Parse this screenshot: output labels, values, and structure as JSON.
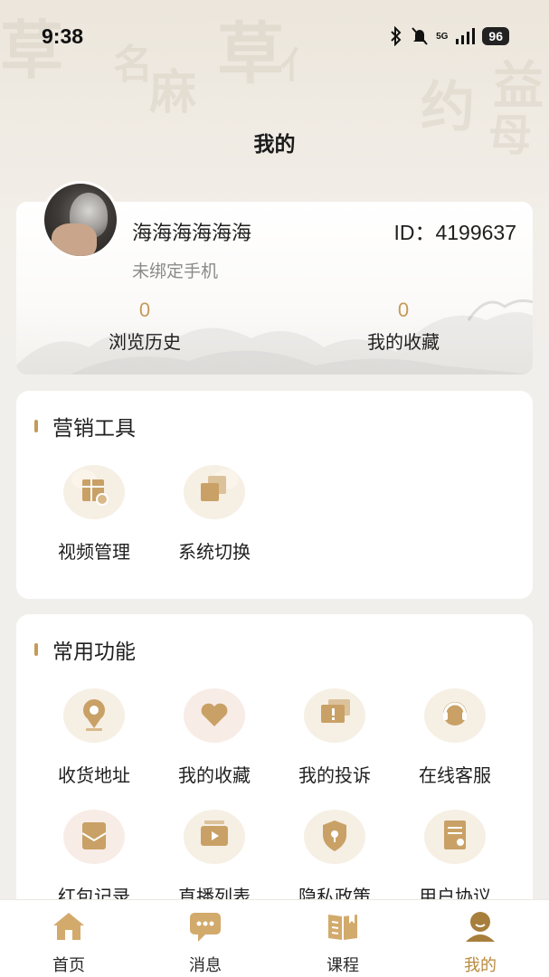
{
  "status_bar": {
    "time": "9:38",
    "network": "5G",
    "battery": "96"
  },
  "header": {
    "title": "我的"
  },
  "profile": {
    "username": "海海海海海海",
    "id_text": "ID：4199637",
    "phone_status": "未绑定手机",
    "stats": [
      {
        "value": "0",
        "label": "浏览历史"
      },
      {
        "value": "0",
        "label": "我的收藏"
      }
    ]
  },
  "marketing": {
    "title": "营销工具",
    "items": [
      {
        "label": "视频管理",
        "icon": "video-manage-icon"
      },
      {
        "label": "系统切换",
        "icon": "system-switch-icon"
      }
    ]
  },
  "common": {
    "title": "常用功能",
    "items": [
      {
        "label": "收货地址",
        "icon": "location-pin-icon"
      },
      {
        "label": "我的收藏",
        "icon": "heart-icon"
      },
      {
        "label": "我的投诉",
        "icon": "complaint-icon"
      },
      {
        "label": "在线客服",
        "icon": "headset-icon"
      },
      {
        "label": "红包记录",
        "icon": "red-envelope-icon"
      },
      {
        "label": "直播列表",
        "icon": "live-camera-icon"
      },
      {
        "label": "隐私政策",
        "icon": "shield-lock-icon"
      },
      {
        "label": "用户协议",
        "icon": "agreement-icon"
      }
    ]
  },
  "tab_bar": {
    "items": [
      {
        "label": "首页",
        "icon": "home-icon"
      },
      {
        "label": "消息",
        "icon": "message-icon"
      },
      {
        "label": "课程",
        "icon": "course-book-icon"
      },
      {
        "label": "我的",
        "icon": "profile-icon"
      }
    ],
    "active_index": 3
  },
  "colors": {
    "accent": "#c59a5a",
    "active_tab": "#b98a3e",
    "background": "#f1efec"
  }
}
